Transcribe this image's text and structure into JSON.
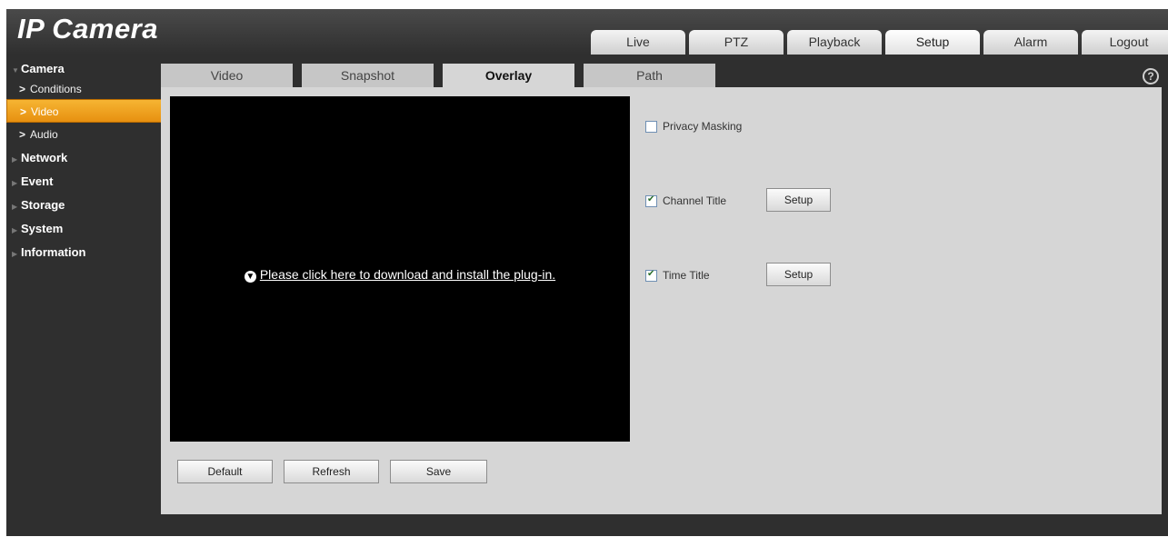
{
  "app": {
    "title": "IP Camera"
  },
  "nav": {
    "tabs": [
      {
        "label": "Live"
      },
      {
        "label": "PTZ"
      },
      {
        "label": "Playback"
      },
      {
        "label": "Setup",
        "active": true
      },
      {
        "label": "Alarm"
      },
      {
        "label": "Logout"
      }
    ]
  },
  "sidebar": {
    "camera": {
      "label": "Camera",
      "items": [
        {
          "label": "Conditions"
        },
        {
          "label": "Video",
          "active": true
        },
        {
          "label": "Audio"
        }
      ]
    },
    "categories": [
      {
        "label": "Network"
      },
      {
        "label": "Event"
      },
      {
        "label": "Storage"
      },
      {
        "label": "System"
      },
      {
        "label": "Information"
      }
    ]
  },
  "tabs": [
    {
      "label": "Video"
    },
    {
      "label": "Snapshot"
    },
    {
      "label": "Overlay",
      "active": true
    },
    {
      "label": "Path"
    }
  ],
  "help": {
    "symbol": "?"
  },
  "video": {
    "plugin_link": "Please click here to download and install the plug-in."
  },
  "options": {
    "privacy_masking": {
      "label": "Privacy Masking",
      "checked": false
    },
    "channel_title": {
      "label": "Channel Title",
      "checked": true,
      "setup_label": "Setup"
    },
    "time_title": {
      "label": "Time Title",
      "checked": true,
      "setup_label": "Setup"
    }
  },
  "actions": {
    "default_label": "Default",
    "refresh_label": "Refresh",
    "save_label": "Save"
  },
  "colors": {
    "accent": "#f0a020",
    "background": "#2f2f2f",
    "panel": "#d6d6d6"
  }
}
